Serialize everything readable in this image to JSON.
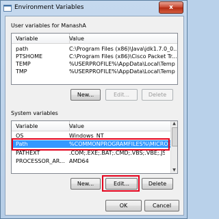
{
  "window": {
    "title": "Environment Variables",
    "close": "x"
  },
  "user_section": {
    "label": "User variables for ManashA",
    "columns": [
      "Variable",
      "Value"
    ],
    "rows": [
      {
        "variable": "path",
        "value": "C:\\Program Files (x86)\\Java\\jdk1.7.0_0..."
      },
      {
        "variable": "PTSHOME",
        "value": "C:\\Program Files (x86)\\Cisco Packet Tr..."
      },
      {
        "variable": "TEMP",
        "value": "%USERPROFILE%\\AppData\\Local\\Temp"
      },
      {
        "variable": "TMP",
        "value": "%USERPROFILE%\\AppData\\Local\\Temp"
      }
    ],
    "buttons": {
      "new": "New...",
      "edit": "Edit...",
      "delete": "Delete"
    }
  },
  "system_section": {
    "label": "System variables",
    "columns": [
      "Variable",
      "Value"
    ],
    "rows": [
      {
        "variable": "OS",
        "value": "Windows_NT"
      },
      {
        "variable": "Path",
        "value": "%COMMONPROGRAMFILES%\\MICROS...",
        "selected": true
      },
      {
        "variable": "PATHEXT",
        "value": ".COM;.EXE;.BAT;.CMD;.VBS;.VBE;.JS;..."
      },
      {
        "variable": "PROCESSOR_AR...",
        "value": "AMD64"
      }
    ],
    "buttons": {
      "new": "New...",
      "edit": "Edit...",
      "delete": "Delete"
    }
  },
  "dialog_buttons": {
    "ok": "OK",
    "cancel": "Cancel"
  },
  "colors": {
    "selection": "#3399ff",
    "highlight": "#e3001b"
  }
}
